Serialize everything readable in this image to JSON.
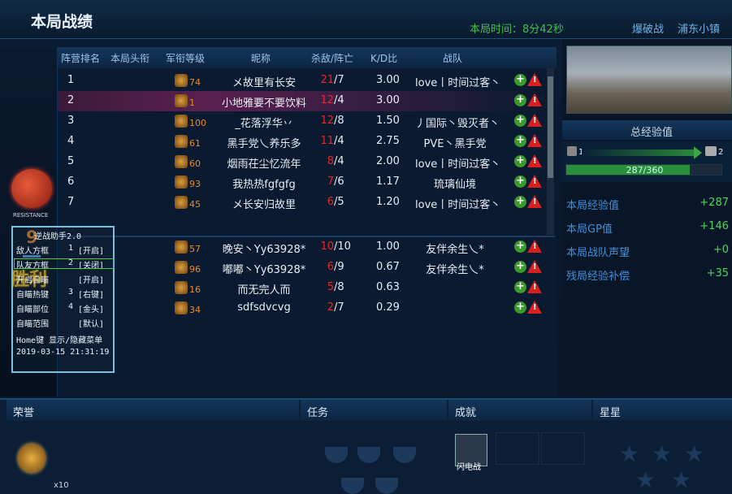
{
  "header": {
    "title": "本局战绩",
    "time": "本局时间：8分42秒",
    "mode": "爆破战",
    "map": "浦东小镇"
  },
  "columns": [
    "阵营排名",
    "本局头衔",
    "军衔等级",
    "昵称",
    "杀敌/阵亡",
    "K/D比",
    "战队"
  ],
  "team_a": [
    {
      "rank": "1",
      "level": "74",
      "name": "メ故里有长安",
      "kills": "21",
      "deaths": "/7",
      "kd": "3.00",
      "clan": "love丨时间过客丶"
    },
    {
      "rank": "2",
      "level": "1",
      "name": "小地雅要不要饮料",
      "kills": "12",
      "deaths": "/4",
      "kd": "3.00",
      "clan": ""
    },
    {
      "rank": "3",
      "level": "100",
      "name": "_花落浮华丷",
      "kills": "12",
      "deaths": "/8",
      "kd": "1.50",
      "clan": "丿国际丶毁灭者丶"
    },
    {
      "rank": "4",
      "level": "61",
      "name": "黑手党乀养乐多",
      "kills": "11",
      "deaths": "/4",
      "kd": "2.75",
      "clan": "PVE丶黑手党"
    },
    {
      "rank": "5",
      "level": "60",
      "name": "烟雨茌尘忆流年",
      "kills": "8",
      "deaths": "/4",
      "kd": "2.00",
      "clan": "love丨时间过客丶"
    },
    {
      "rank": "6",
      "level": "93",
      "name": "我热热fgfgfg",
      "kills": "7",
      "deaths": "/6",
      "kd": "1.17",
      "clan": "琉璃仙境"
    },
    {
      "rank": "7",
      "level": "45",
      "name": "メ长安归故里",
      "kills": "6",
      "deaths": "/5",
      "kd": "1.20",
      "clan": "love丨时间过客丶"
    }
  ],
  "team_b": [
    {
      "level": "57",
      "name": "晚安丶Yy63928*",
      "kills": "10",
      "deaths": "/10",
      "kd": "1.00",
      "clan": "友伴余生乀*"
    },
    {
      "level": "96",
      "name": "嘟嘟丶Yy63928*",
      "kills": "6",
      "deaths": "/9",
      "kd": "0.67",
      "clan": "友伴余生乀*"
    },
    {
      "level": "16",
      "name": "而无完人而",
      "kills": "5",
      "deaths": "/8",
      "kd": "0.63",
      "clan": ""
    },
    {
      "level": "34",
      "name": "sdfsdvcvg",
      "kills": "2",
      "deaths": "/7",
      "kd": "0.29",
      "clan": ""
    }
  ],
  "left": {
    "resistance": "RESISTANCE",
    "team_rank": "9",
    "result": "胜利"
  },
  "right": {
    "total_xp_label": "总经验值",
    "level_from": "1",
    "level_to": "2",
    "xp_text": "287/360",
    "xp_fraction": 0.797,
    "stats": [
      {
        "label": "本局经验值",
        "value": "+287"
      },
      {
        "label": "本局GP值",
        "value": "+146"
      },
      {
        "label": "本局战队声望",
        "value": "+0"
      },
      {
        "label": "残局经验补偿",
        "value": "+35"
      }
    ]
  },
  "overlay": {
    "title": "逆战助手2.0",
    "lines": [
      [
        "敌人方框",
        "1",
        "[开启]"
      ],
      [
        "队友方框",
        "2",
        "[关闭]"
      ],
      [
        "开启自瞄",
        "",
        "[开启]"
      ],
      [
        "自瞄热键",
        "3",
        "[右键]"
      ],
      [
        "自瞄部位",
        "4",
        "[金头]"
      ],
      [
        "自瞄范围",
        "",
        "[默认]"
      ]
    ],
    "footer": "Home键 显示/隐藏菜单",
    "timestamp": "2019-03-15 21:31:19"
  },
  "bottom": {
    "honor": "荣誉",
    "task": "任务",
    "achievement": "成就",
    "stars": "星星",
    "medal_count": "x10",
    "ach_name": "闪电战"
  }
}
